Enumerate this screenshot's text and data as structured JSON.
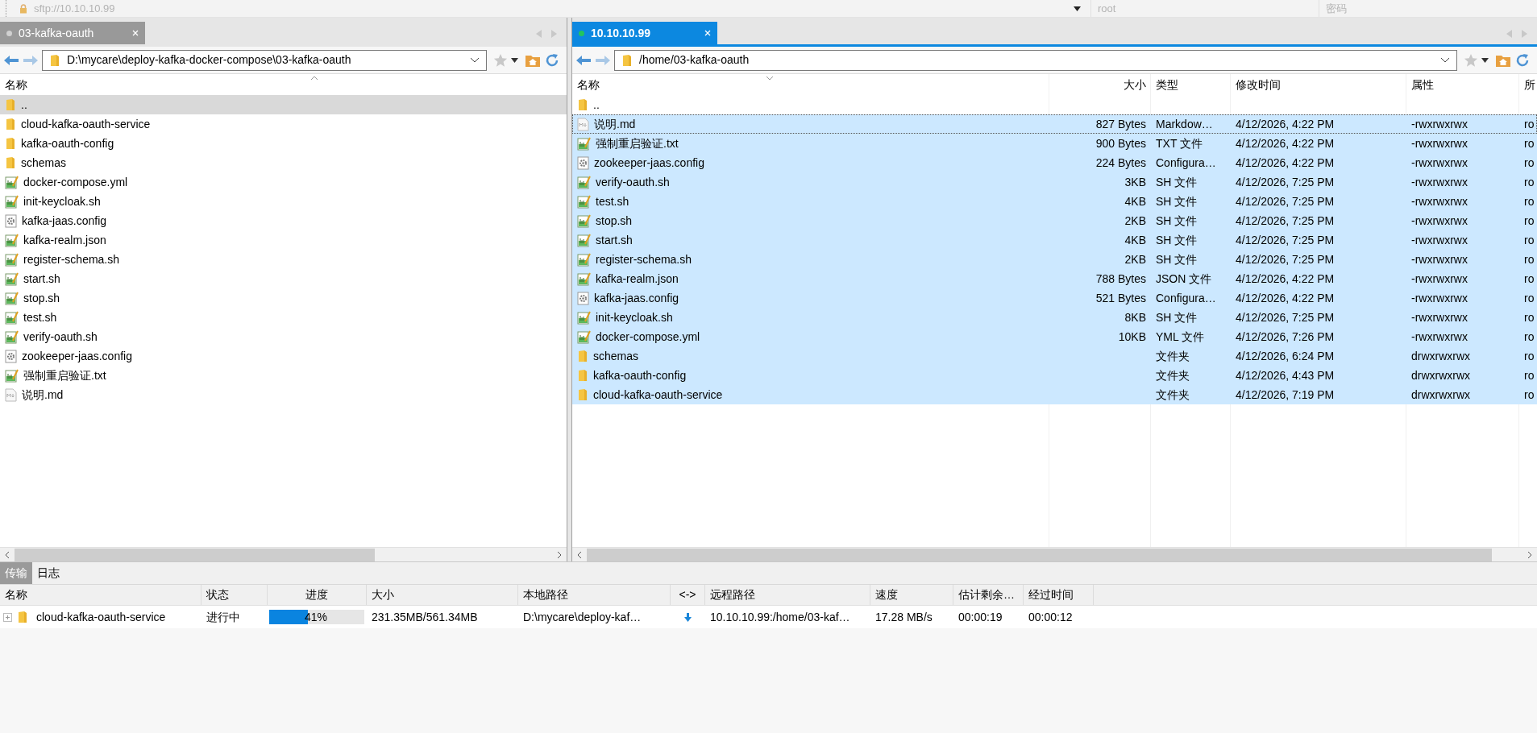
{
  "connection": {
    "host": "sftp://10.10.10.99",
    "user": "root",
    "password_placeholder": "密码"
  },
  "local_pane": {
    "tab": {
      "label": "03-kafka-oauth",
      "selected": false
    },
    "path": "D:\\mycare\\deploy-kafka-docker-compose\\03-kafka-oauth",
    "columns": [
      "名称"
    ],
    "rows": [
      {
        "name": "..",
        "kind": "folder",
        "selected": true
      },
      {
        "name": "cloud-kafka-oauth-service",
        "kind": "folder",
        "selected": false
      },
      {
        "name": "kafka-oauth-config",
        "kind": "folder",
        "selected": false
      },
      {
        "name": "schemas",
        "kind": "folder",
        "selected": false
      },
      {
        "name": "docker-compose.yml",
        "kind": "script",
        "selected": false
      },
      {
        "name": "init-keycloak.sh",
        "kind": "script",
        "selected": false
      },
      {
        "name": "kafka-jaas.config",
        "kind": "config",
        "selected": false
      },
      {
        "name": "kafka-realm.json",
        "kind": "script",
        "selected": false
      },
      {
        "name": "register-schema.sh",
        "kind": "script",
        "selected": false
      },
      {
        "name": "start.sh",
        "kind": "script",
        "selected": false
      },
      {
        "name": "stop.sh",
        "kind": "script",
        "selected": false
      },
      {
        "name": "test.sh",
        "kind": "script",
        "selected": false
      },
      {
        "name": "verify-oauth.sh",
        "kind": "script",
        "selected": false
      },
      {
        "name": "zookeeper-jaas.config",
        "kind": "config",
        "selected": false
      },
      {
        "name": "强制重启验证.txt",
        "kind": "script",
        "selected": false
      },
      {
        "name": "说明.md",
        "kind": "markdown",
        "selected": false
      }
    ]
  },
  "remote_pane": {
    "tab": {
      "label": "10.10.10.99",
      "selected": true
    },
    "path": "/home/03-kafka-oauth",
    "columns": [
      "名称",
      "大小",
      "类型",
      "修改时间",
      "属性",
      "所"
    ],
    "rows": [
      {
        "name": "..",
        "kind": "folder",
        "selected": false,
        "focused": false
      },
      {
        "name": "说明.md",
        "kind": "markdown",
        "size": "827 Bytes",
        "type": "Markdow…",
        "modified": "4/12/2026, 4:22 PM",
        "attributes": "-rwxrwxrwx",
        "column_6": "ro",
        "selected": true,
        "focused": true
      },
      {
        "name": "强制重启验证.txt",
        "kind": "script",
        "size": "900 Bytes",
        "type": "TXT 文件",
        "modified": "4/12/2026, 4:22 PM",
        "attributes": "-rwxrwxrwx",
        "column_6": "ro",
        "selected": true,
        "focused": false
      },
      {
        "name": "zookeeper-jaas.config",
        "kind": "config",
        "size": "224 Bytes",
        "type": "Configura…",
        "modified": "4/12/2026, 4:22 PM",
        "attributes": "-rwxrwxrwx",
        "column_6": "ro",
        "selected": true,
        "focused": false
      },
      {
        "name": "verify-oauth.sh",
        "kind": "script",
        "size": "3KB",
        "type": "SH 文件",
        "modified": "4/12/2026, 7:25 PM",
        "attributes": "-rwxrwxrwx",
        "column_6": "ro",
        "selected": true,
        "focused": false
      },
      {
        "name": "test.sh",
        "kind": "script",
        "size": "4KB",
        "type": "SH 文件",
        "modified": "4/12/2026, 7:25 PM",
        "attributes": "-rwxrwxrwx",
        "column_6": "ro",
        "selected": true,
        "focused": false
      },
      {
        "name": "stop.sh",
        "kind": "script",
        "size": "2KB",
        "type": "SH 文件",
        "modified": "4/12/2026, 7:25 PM",
        "attributes": "-rwxrwxrwx",
        "column_6": "ro",
        "selected": true,
        "focused": false
      },
      {
        "name": "start.sh",
        "kind": "script",
        "size": "4KB",
        "type": "SH 文件",
        "modified": "4/12/2026, 7:25 PM",
        "attributes": "-rwxrwxrwx",
        "column_6": "ro",
        "selected": true,
        "focused": false
      },
      {
        "name": "register-schema.sh",
        "kind": "script",
        "size": "2KB",
        "type": "SH 文件",
        "modified": "4/12/2026, 7:25 PM",
        "attributes": "-rwxrwxrwx",
        "column_6": "ro",
        "selected": true,
        "focused": false
      },
      {
        "name": "kafka-realm.json",
        "kind": "script",
        "size": "788 Bytes",
        "type": "JSON 文件",
        "modified": "4/12/2026, 4:22 PM",
        "attributes": "-rwxrwxrwx",
        "column_6": "ro",
        "selected": true,
        "focused": false
      },
      {
        "name": "kafka-jaas.config",
        "kind": "config",
        "size": "521 Bytes",
        "type": "Configura…",
        "modified": "4/12/2026, 4:22 PM",
        "attributes": "-rwxrwxrwx",
        "column_6": "ro",
        "selected": true,
        "focused": false
      },
      {
        "name": "init-keycloak.sh",
        "kind": "script",
        "size": "8KB",
        "type": "SH 文件",
        "modified": "4/12/2026, 7:25 PM",
        "attributes": "-rwxrwxrwx",
        "column_6": "ro",
        "selected": true,
        "focused": false
      },
      {
        "name": "docker-compose.yml",
        "kind": "script",
        "size": "10KB",
        "type": "YML 文件",
        "modified": "4/12/2026, 7:26 PM",
        "attributes": "-rwxrwxrwx",
        "column_6": "ro",
        "selected": true,
        "focused": false
      },
      {
        "name": "schemas",
        "kind": "folder",
        "type": "文件夹",
        "modified": "4/12/2026, 6:24 PM",
        "attributes": "drwxrwxrwx",
        "column_6": "ro",
        "selected": true,
        "focused": false
      },
      {
        "name": "kafka-oauth-config",
        "kind": "folder",
        "type": "文件夹",
        "modified": "4/12/2026, 4:43 PM",
        "attributes": "drwxrwxrwx",
        "column_6": "ro",
        "selected": true,
        "focused": false
      },
      {
        "name": "cloud-kafka-oauth-service",
        "kind": "folder",
        "type": "文件夹",
        "modified": "4/12/2026, 7:19 PM",
        "attributes": "drwxrwxrwx",
        "column_6": "ro",
        "selected": true,
        "focused": false
      }
    ]
  },
  "transfer": {
    "tabs": [
      {
        "label": "传输",
        "selected": true
      },
      {
        "label": "日志",
        "selected": false
      }
    ],
    "columns": [
      "名称",
      "状态",
      "进度",
      "大小",
      "本地路径",
      "<->",
      "远程路径",
      "速度",
      "估计剩余…",
      "经过时间"
    ],
    "rows": [
      {
        "name": "cloud-kafka-oauth-service",
        "status": "进行中",
        "progress": {
          "level": 0.41,
          "text": "41%"
        },
        "size": "231.35MB/561.34MB",
        "local_path": "D:\\mycare\\deploy-kaf…",
        "remote_path": "10.10.10.99:/home/03-kaf…",
        "speed": "17.28 MB/s",
        "remaining": "00:00:19",
        "elapsed": "00:00:12"
      }
    ]
  }
}
